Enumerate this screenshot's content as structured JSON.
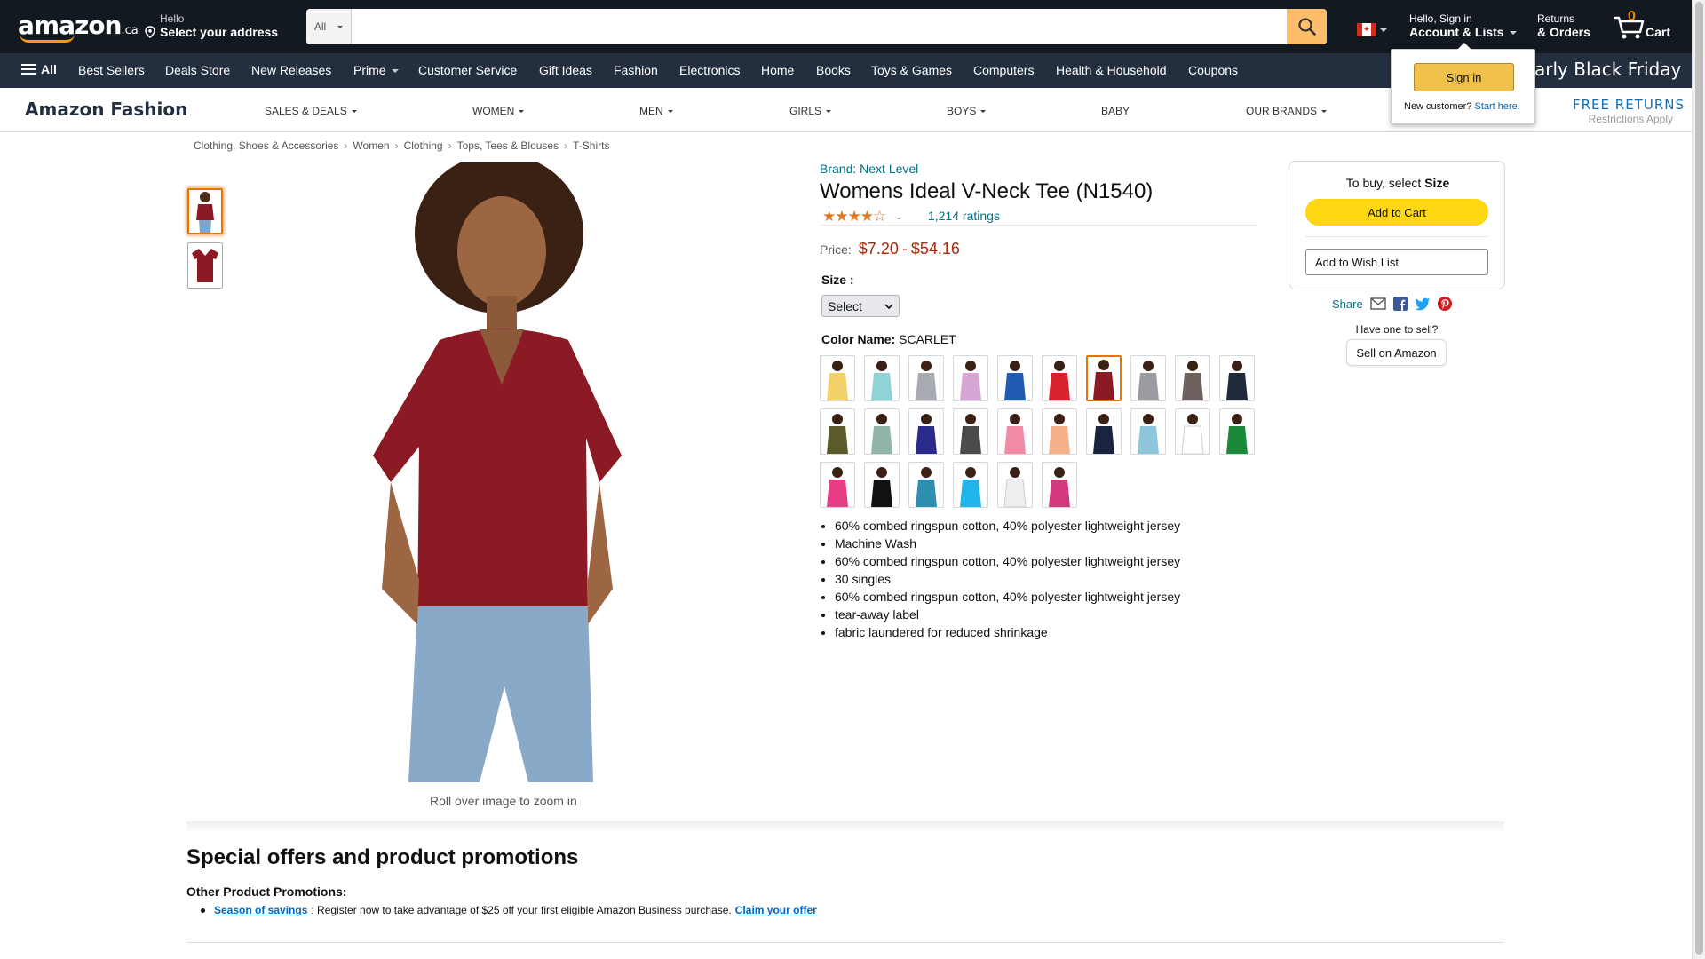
{
  "header": {
    "logo_text": "amazon",
    "logo_suffix": ".ca",
    "address_line1": "Hello",
    "address_line2": "Select your address",
    "search_category": "All",
    "search_placeholder": "",
    "account_line1": "Hello, Sign in",
    "account_line2": "Account & Lists",
    "returns_line1": "Returns",
    "returns_line2": "& Orders",
    "cart_count": "0",
    "cart_label": "Cart"
  },
  "subnav": {
    "all_label": "All",
    "items": [
      "Best Sellers",
      "Deals Store",
      "New Releases",
      "Prime",
      "Customer Service",
      "Gift Ideas",
      "Fashion",
      "Electronics",
      "Home",
      "Books",
      "Toys & Games",
      "Computers",
      "Health & Household",
      "Coupons"
    ],
    "promo": "arly Black Friday"
  },
  "flyout": {
    "signin_label": "Sign in",
    "new_customer": "New customer?",
    "start_here": "Start here."
  },
  "fashion_bar": {
    "title": "Amazon Fashion",
    "items": [
      "SALES & DEALS",
      "WOMEN",
      "MEN",
      "GIRLS",
      "BOYS",
      "BABY",
      "OUR BRANDS"
    ],
    "free_returns": "FREE RETURNS",
    "restrictions": "Restrictions Apply"
  },
  "breadcrumb": [
    "Clothing, Shoes & Accessories",
    "Women",
    "Clothing",
    "Tops, Tees & Blouses",
    "T-Shirts"
  ],
  "product": {
    "brand": "Brand: Next Level",
    "title": "Womens Ideal V-Neck Tee (N1540)",
    "rating_stars": 4,
    "ratings_text": "1,214 ratings",
    "price_label": "Price:",
    "price_low": "$7.20",
    "price_sep": "-",
    "price_high": "$54.16",
    "size_label": "Size :",
    "size_value": "Select",
    "color_label": "Color Name:",
    "color_value": "SCARLET",
    "main_color": "#8b1a24",
    "zoom_hint": "Roll over image to zoom in",
    "bullets": [
      "60% combed ringspun cotton, 40% polyester lightweight jersey",
      "Machine Wash",
      "60% combed ringspun cotton, 40% polyester lightweight jersey",
      "30 singles",
      "60% combed ringspun cotton, 40% polyester lightweight jersey",
      "tear-away label",
      "fabric laundered for reduced shrinkage"
    ],
    "swatches": [
      "#f2d16b",
      "#8fd3d6",
      "#a9abb2",
      "#d7a6d4",
      "#1f5bb3",
      "#d8222f",
      "#8b1a24",
      "#9a9ca1",
      "#6e6260",
      "#1f2a3a",
      "#5a5a2a",
      "#8fb5a8",
      "#2a2a8c",
      "#4a4a4a",
      "#f08ba3",
      "#f5b08a",
      "#1a2340",
      "#8ec7db",
      "#ffffff",
      "#1a8a3a",
      "#e53d86",
      "#111111",
      "#2f8fb0",
      "#20b4e8",
      "#eeeeee",
      "#d43b7f"
    ],
    "selected_swatch": 6
  },
  "buybox": {
    "to_buy_prefix": "To buy, select",
    "to_buy_bold": "Size",
    "add_to_cart": "Add to Cart",
    "add_to_wishlist": "Add to Wish List",
    "share_label": "Share",
    "have_one": "Have one to sell?",
    "sell_label": "Sell on Amazon"
  },
  "promotions": {
    "title": "Special offers and product promotions",
    "other": "Other Product Promotions:",
    "link": "Season of savings",
    "text": ": Register now to take advantage of $25 off your first eligible Amazon Business purchase.",
    "claim": "Claim your offer"
  }
}
